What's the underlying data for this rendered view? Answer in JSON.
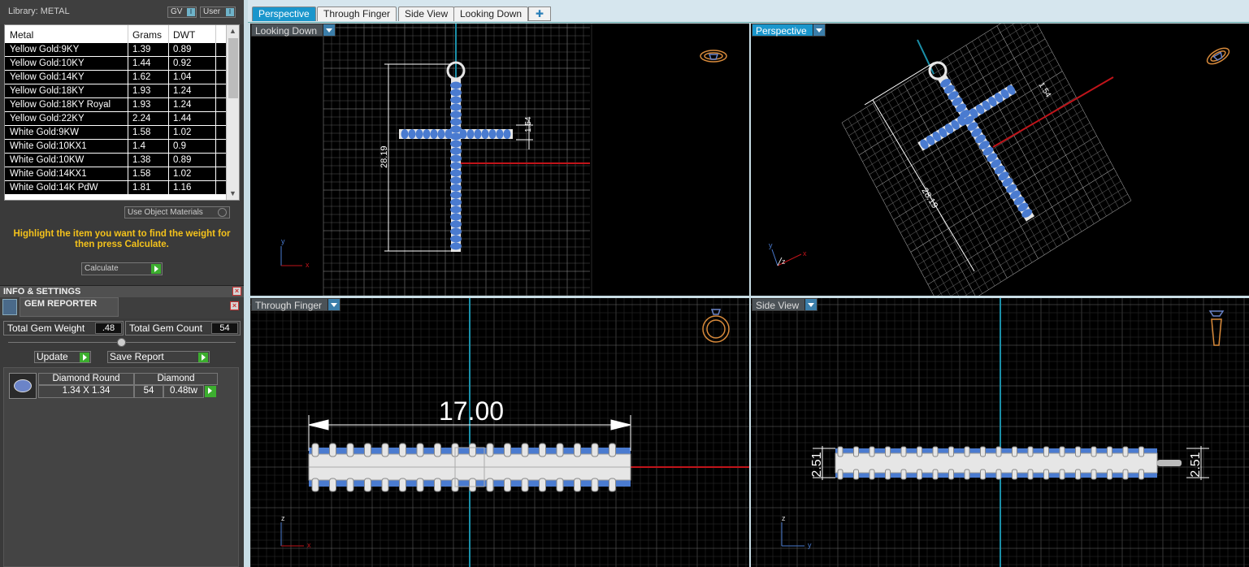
{
  "library": {
    "title": "Library: METAL",
    "toggle_gv": "GV",
    "toggle_user": "User",
    "columns": [
      "Metal",
      "Grams",
      "DWT"
    ],
    "rows": [
      [
        "Yellow Gold:9KY",
        "1.39",
        "0.89"
      ],
      [
        "Yellow Gold:10KY",
        "1.44",
        "0.92"
      ],
      [
        "Yellow Gold:14KY",
        "1.62",
        "1.04"
      ],
      [
        "Yellow Gold:18KY",
        "1.93",
        "1.24"
      ],
      [
        "Yellow Gold:18KY Royal",
        "1.93",
        "1.24"
      ],
      [
        "Yellow Gold:22KY",
        "2.24",
        "1.44"
      ],
      [
        "White Gold:9KW",
        "1.58",
        "1.02"
      ],
      [
        "White Gold:10KX1",
        "1.4",
        "0.9"
      ],
      [
        "White Gold:10KW",
        "1.38",
        "0.89"
      ],
      [
        "White Gold:14KX1",
        "1.58",
        "1.02"
      ],
      [
        "White Gold:14K PdW",
        "1.81",
        "1.16"
      ]
    ],
    "use_object_materials": "Use Object Materials",
    "hint": "Highlight the item you want to find the weight for then press Calculate.",
    "calculate": "Calculate"
  },
  "info": {
    "title": "INFO & SETTINGS",
    "gem_reporter_title": "GEM REPORTER",
    "total_gem_weight_label": "Total Gem Weight",
    "total_gem_weight": ".48",
    "total_gem_count_label": "Total Gem Count",
    "total_gem_count": "54",
    "update": "Update",
    "save_report": "Save Report",
    "gem": {
      "shape": "Diamond Round",
      "material": "Diamond",
      "size": "1.34 X 1.34",
      "count": "54",
      "weight": "0.48tw"
    }
  },
  "tabs": [
    "Perspective",
    "Through Finger",
    "Side View",
    "Looking Down"
  ],
  "active_tab": "Perspective",
  "viewports": {
    "looking_down": {
      "label": "Looking Down",
      "dim_length": "28.19",
      "dim_width": "1.54"
    },
    "perspective": {
      "label": "Perspective",
      "dim_length": "28.19",
      "dim_width": "1.54"
    },
    "through_finger": {
      "label": "Through Finger",
      "dim_length": "17.00"
    },
    "side_view": {
      "label": "Side View",
      "dim_left": "2.51",
      "dim_right": "2.51"
    }
  },
  "axes": {
    "x": "x",
    "y": "y",
    "z": "z"
  },
  "colors": {
    "accent": "#1a96cc",
    "hint": "#f4c21b",
    "gem": "#4a7bd0",
    "metal": "#e6e6e6",
    "axis_red": "#c0141a",
    "axis_cyan": "#1b8fa8"
  }
}
